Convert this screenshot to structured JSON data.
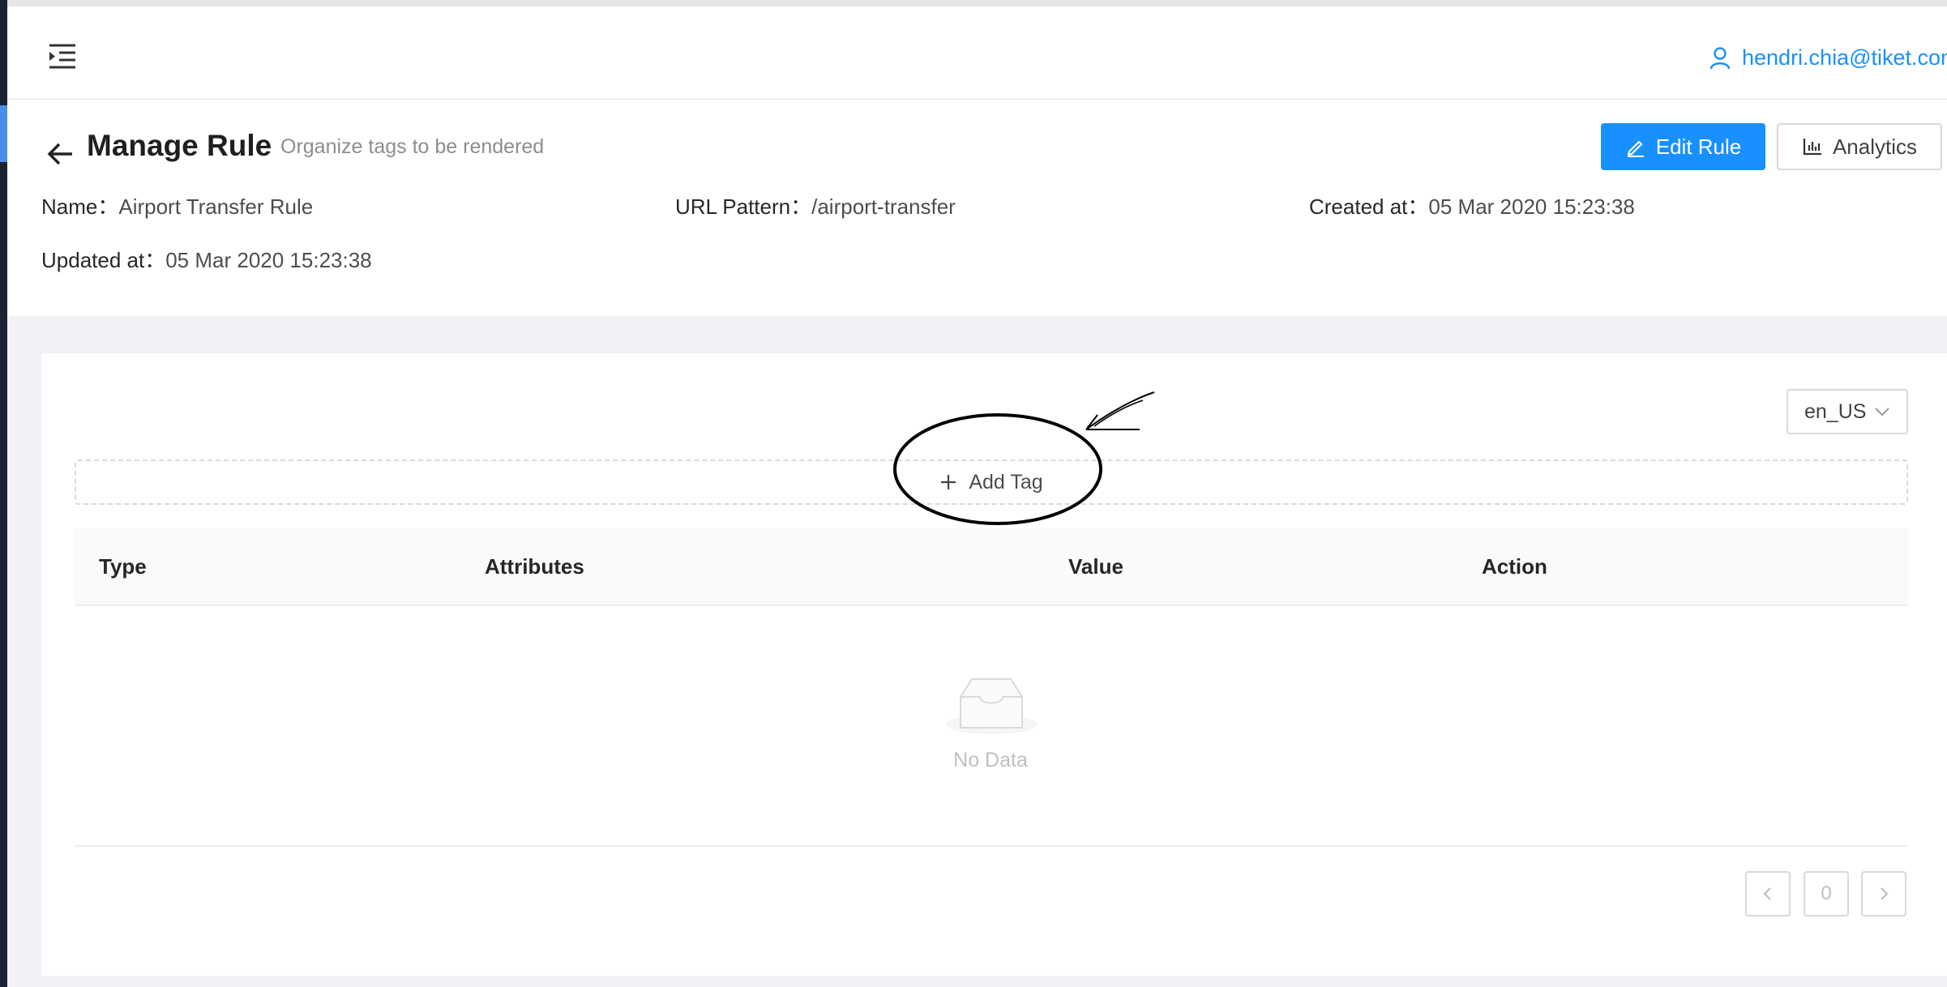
{
  "user": {
    "email": "hendri.chia@tiket.com"
  },
  "header": {
    "title": "Manage Rule",
    "subtitle": "Organize tags to be rendered",
    "edit_button": "Edit Rule",
    "analytics_button": "Analytics"
  },
  "details": {
    "name_label": "Name：",
    "name_value": "Airport Transfer Rule",
    "url_label": "URL Pattern：",
    "url_value": "/airport-transfer",
    "created_label": "Created at：",
    "created_value": "05 Mar 2020 15:23:38",
    "updated_label": "Updated at：",
    "updated_value": "05 Mar 2020 15:23:38"
  },
  "locale": {
    "selected": "en_US"
  },
  "add_tag": {
    "label": "Add Tag"
  },
  "table": {
    "columns": [
      "Type",
      "Attributes",
      "Value",
      "Action"
    ],
    "rows": [],
    "empty_text": "No Data"
  },
  "pagination": {
    "current": "0"
  },
  "colors": {
    "primary": "#1890ff",
    "sidebar": "#1b2233",
    "content_bg": "#f0f2f5"
  },
  "icons": {
    "menu": "menu-fold-icon",
    "user": "user-icon",
    "back": "arrow-left-icon",
    "edit": "edit-icon",
    "analytics": "bar-chart-icon",
    "select": "chevron-down-icon",
    "add": "plus-icon",
    "empty": "inbox-icon",
    "prev": "chevron-left-icon",
    "next": "chevron-right-icon"
  }
}
